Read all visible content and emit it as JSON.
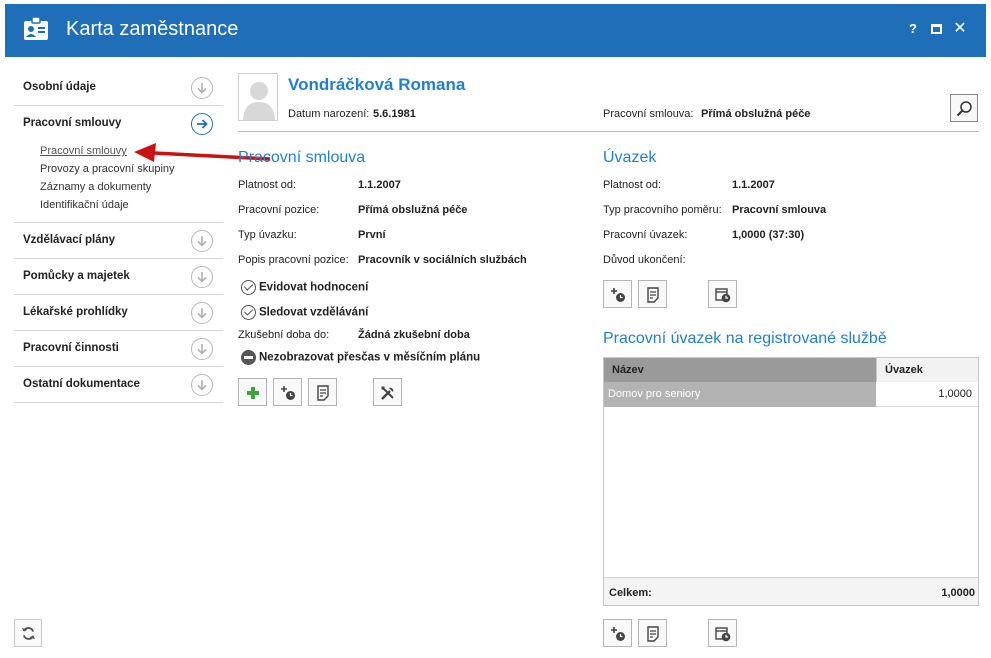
{
  "window": {
    "title": "Karta zaměstnance",
    "help_label": "?",
    "close_label": "✕",
    "accent": "#1f6fb8"
  },
  "sidebar": {
    "items": [
      {
        "label": "Osobní údaje"
      },
      {
        "label": "Pracovní smlouvy"
      },
      {
        "label": "Vzdělávací plány"
      },
      {
        "label": "Pomůcky a majetek"
      },
      {
        "label": "Lékařské prohlídky"
      },
      {
        "label": "Pracovní činnosti"
      },
      {
        "label": "Ostatní dokumentace"
      }
    ],
    "subitems": [
      {
        "label": "Pracovní smlouvy"
      },
      {
        "label": "Provozy a pracovní skupiny"
      },
      {
        "label": "Záznamy a dokumenty"
      },
      {
        "label": "Identifikační údaje"
      }
    ]
  },
  "header": {
    "name": "Vondráčková Romana",
    "dob_label": "Datum narození:",
    "dob_value": "5.6.1981",
    "contract_label": "Pracovní smlouva:",
    "contract_value": "Přímá obslužná péče"
  },
  "contract": {
    "title": "Pracovní smlouva",
    "fields": [
      {
        "label": "Platnost od:",
        "value": "1.1.2007"
      },
      {
        "label": "Pracovní pozice:",
        "value": "Přímá obslužná péče"
      },
      {
        "label": "Typ úvazku:",
        "value": "První"
      },
      {
        "label": "Popis pracovní pozice:",
        "value": "Pracovník v sociálních službách"
      }
    ],
    "flag_evaluation": "Evidovat hodnocení",
    "flag_education": "Sledovat vzdělávání",
    "probation_label": "Zkušební doba do:",
    "probation_value": "Žádná zkušební doba",
    "flag_overtime": "Nezobrazovat přesčas v měsíčním plánu"
  },
  "workload": {
    "title": "Úvazek",
    "fields": [
      {
        "label": "Platnost od:",
        "value": "1.1.2007"
      },
      {
        "label": "Typ pracovního poměru:",
        "value": "Pracovní smlouva"
      },
      {
        "label": "Pracovní úvazek:",
        "value": "1,0000 (37:30)"
      },
      {
        "label": "Důvod ukončení:",
        "value": ""
      }
    ]
  },
  "service": {
    "title": "Pracovní úvazek na registrované službě",
    "columns": [
      "Název",
      "Úvazek"
    ],
    "rows": [
      {
        "name": "Domov pro seniory",
        "value": "1,0000"
      }
    ],
    "total_label": "Celkem:",
    "total_value": "1,0000"
  }
}
